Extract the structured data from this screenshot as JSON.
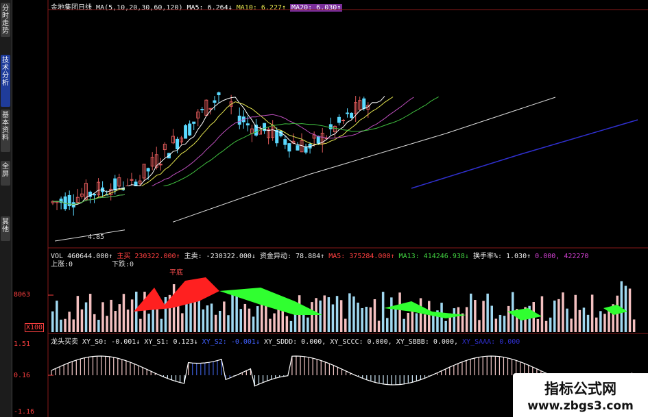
{
  "sidebar": {
    "tabs": [
      {
        "label": "分时走势",
        "active": false
      },
      {
        "label": "技术分析",
        "active": true
      },
      {
        "label": "基本资料",
        "active": false
      },
      {
        "label": "全屏",
        "active": false
      },
      {
        "label": "其他",
        "active": false
      }
    ]
  },
  "price_header": {
    "stock_name": "金地集团日线",
    "ma_params": "MA(5,10,20,30,60,120)",
    "ma5": "MA5: 6.264↓",
    "ma10": "MA10: 6.227↑",
    "ma20": "MA20: 6.030↑"
  },
  "price_panel": {
    "low_marker": "4.85",
    "colors": {
      "up": "#e05a5a",
      "down": "#5ad9ff",
      "ma5": "#ffffff",
      "ma10": "#e8e850",
      "ma20": "#c050c0",
      "ma30": "#40c040",
      "ma60": "#dddddd",
      "ma120": "#3030d0"
    }
  },
  "volume_header": {
    "vol": "VOL 460644.000↑",
    "main_buy_label": "主买",
    "main_buy_value": "230322.000↑",
    "main_sell": "主卖: -230322.000↓",
    "capital_move": "资金异动: 78.884↑",
    "ma5": "MA5: 375284.000↑",
    "ma13": "MA13: 414246.938↓",
    "turnover_label": "换手率%: 1.030↑",
    "extra1": "0.000,",
    "extra2": "422270",
    "up_drop": "上涨:0",
    "down_drop": "下跌:0",
    "trough": "平底"
  },
  "volume_axis": {
    "top_value": "8063",
    "unit": "X100"
  },
  "indicator_header": {
    "name": "龙头买卖",
    "xy_s0": "XY_S0: -0.001↓",
    "xy_s1": "XY_S1: 0.123↓",
    "xy_s2": "XY_S2: -0.001↓",
    "xy_sddd": "XY_SDDD: 0.000,",
    "xy_sccc": "XY_SCCC: 0.000,",
    "xy_sbbb": "XY_SBBB: 0.000,",
    "xy_saaa": "XY_SAAA: 0.000"
  },
  "indicator_axis": {
    "top": "1.51",
    "mid": "0.16",
    "bottom": "-1.16"
  },
  "watermark": {
    "line1": "指标公式网",
    "line2": "www.zbgs3.com"
  }
}
